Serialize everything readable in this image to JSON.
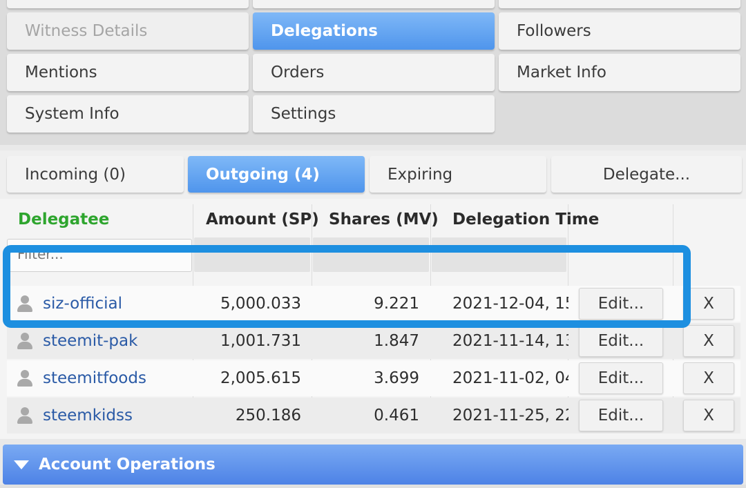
{
  "menu": {
    "witness_details": "Witness Details",
    "delegations": "Delegations",
    "followers": "Followers",
    "mentions": "Mentions",
    "orders": "Orders",
    "market_info": "Market Info",
    "system_info": "System Info",
    "settings": "Settings"
  },
  "subtabs": {
    "incoming": "Incoming (0)",
    "outgoing": "Outgoing (4)",
    "expiring": "Expiring",
    "delegate": "Delegate..."
  },
  "table": {
    "headers": {
      "delegatee": "Delegatee",
      "amount": "Amount (SP)",
      "shares": "Shares (MV)",
      "time": "Delegation Time"
    },
    "filter_placeholder": "Filter...",
    "edit_label": "Edit...",
    "remove_label": "X",
    "rows": [
      {
        "user": "siz-official",
        "amount": "5,000.033",
        "shares": "9.221",
        "time": "2021-12-04, 15:"
      },
      {
        "user": "steemit-pak",
        "amount": "1,001.731",
        "shares": "1.847",
        "time": "2021-11-14, 13:"
      },
      {
        "user": "steemitfoods",
        "amount": "2,005.615",
        "shares": "3.699",
        "time": "2021-11-02, 04:"
      },
      {
        "user": "steemkidss",
        "amount": "250.186",
        "shares": "0.461",
        "time": "2021-11-25, 22:"
      }
    ]
  },
  "account_operations": "Account Operations",
  "colors": {
    "accent": "#4f95ec",
    "highlight": "#1d8fe0",
    "delegatee_header": "#2ea52e",
    "link": "#2a5aa6"
  }
}
